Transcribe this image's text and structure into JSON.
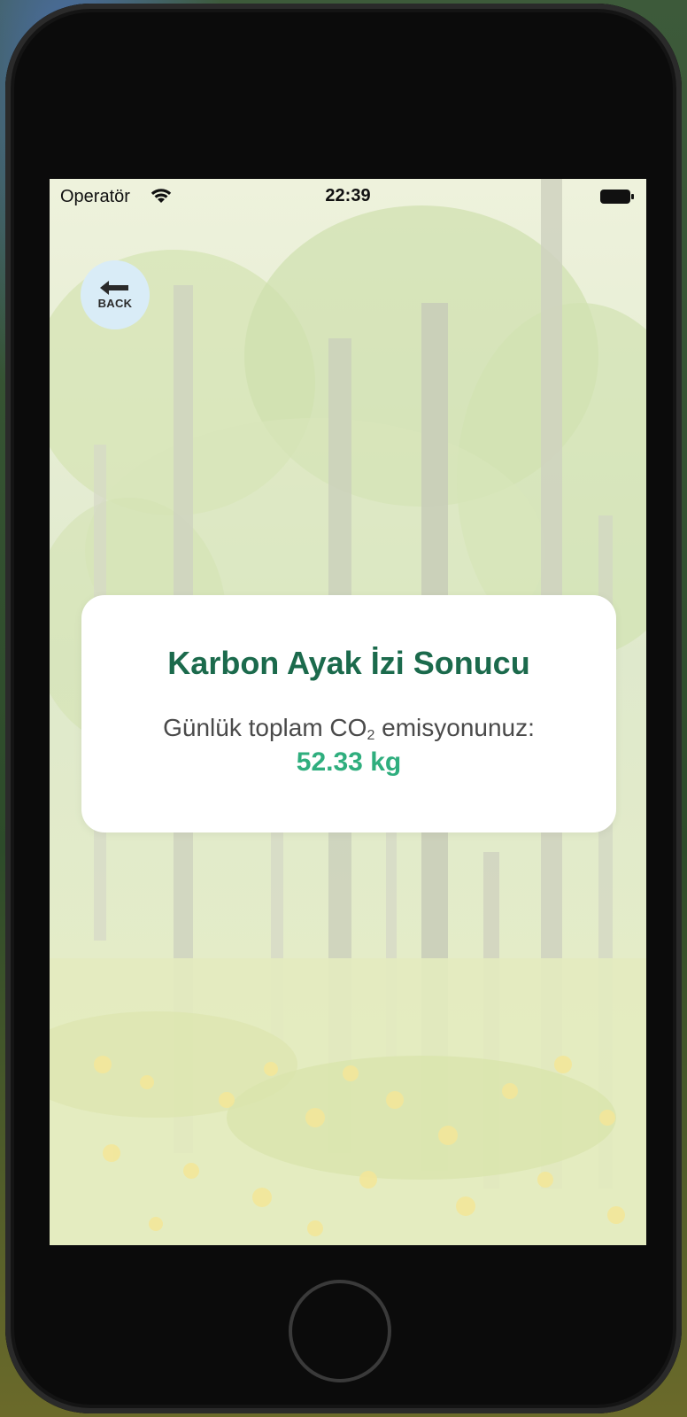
{
  "status_bar": {
    "carrier": "Operatör",
    "time": "22:39"
  },
  "back_button": {
    "label": "BACK",
    "icon": "arrow-left-icon"
  },
  "result_card": {
    "title": "Karbon Ayak İzi Sonucu",
    "description_prefix": "Günlük toplam CO",
    "description_subscript": "2",
    "description_suffix": " emisyonunuz:",
    "value": "52.33 kg"
  },
  "colors": {
    "title_color": "#1b6a4c",
    "value_color": "#2fae7e",
    "back_button_bg": "#d9ecf7",
    "card_bg": "#ffffff"
  }
}
